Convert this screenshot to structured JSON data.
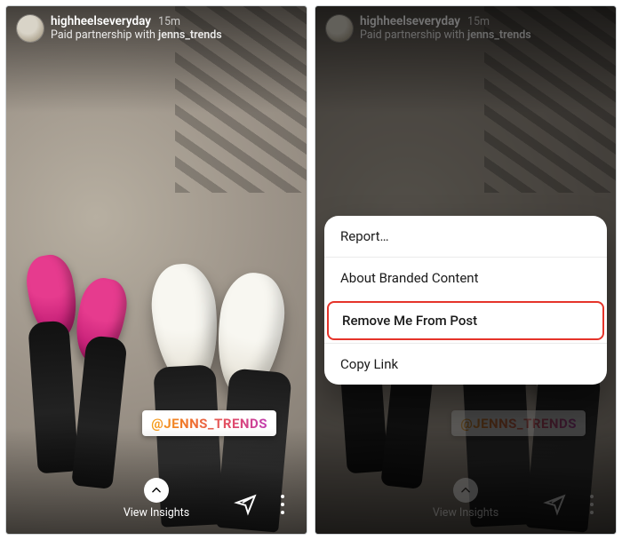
{
  "story": {
    "username": "highheelseveryday",
    "time": "15m",
    "subline_prefix": "Paid partnership with ",
    "partner": "jenns_trends",
    "mention_sticker": "@JENNS_TRENDS",
    "view_insights_label": "View Insights"
  },
  "action_sheet": {
    "items": [
      {
        "label": "Report…"
      },
      {
        "label": "About Branded Content"
      },
      {
        "label": "Remove Me From Post",
        "highlight": true
      },
      {
        "label": "Copy Link"
      }
    ]
  }
}
